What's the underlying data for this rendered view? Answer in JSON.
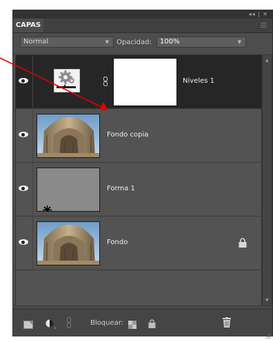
{
  "panel": {
    "tab": "CAPAS",
    "window_controls": "◂◂ | ✕",
    "blend_mode": "Normal",
    "opacity_label": "Opacidad:",
    "opacity_value": "100%",
    "lock_label": "Bloquear:"
  },
  "layers": [
    {
      "name": "Niveles 1",
      "type": "adjustment",
      "visible": true,
      "selected": true
    },
    {
      "name": "Fondo copia",
      "type": "image",
      "visible": true,
      "selected": false
    },
    {
      "name": "Forma 1",
      "type": "shape",
      "visible": true,
      "selected": false
    },
    {
      "name": "Fondo",
      "type": "image",
      "visible": true,
      "selected": false,
      "locked": true
    }
  ],
  "colors": {
    "panel": "#4d4d4d",
    "selected_row": "#262626",
    "annotation_arrow": "#e00000"
  },
  "icons": [
    "eye-icon",
    "chain-link-icon",
    "lock-icon",
    "new-layer-icon",
    "adjustment-layer-icon",
    "trash-icon",
    "lock-transparency-icon",
    "panel-menu-icon"
  ]
}
